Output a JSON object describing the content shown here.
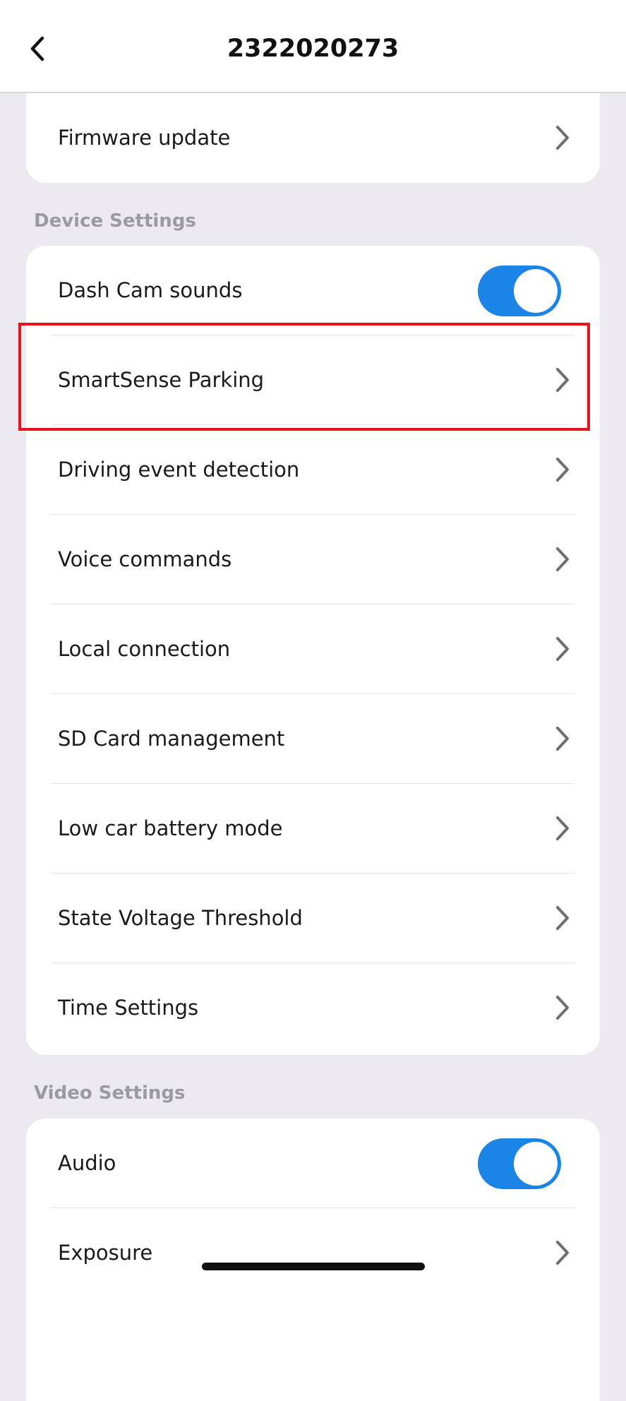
{
  "header": {
    "title": "2322020273",
    "back_icon": "chevron-left-icon"
  },
  "top_card": {
    "rows": [
      {
        "label": "Firmware update",
        "icon": "chevron-right-icon"
      }
    ]
  },
  "device_settings": {
    "section_label": "Device Settings",
    "toggle_row": {
      "label": "Dash Cam sounds",
      "enabled": true
    },
    "rows": [
      {
        "label": "SmartSense Parking",
        "icon": "chevron-right-icon"
      },
      {
        "label": "Driving event detection",
        "icon": "chevron-right-icon"
      },
      {
        "label": "Voice commands",
        "icon": "chevron-right-icon"
      },
      {
        "label": "Local connection",
        "icon": "chevron-right-icon"
      },
      {
        "label": "SD Card management",
        "icon": "chevron-right-icon"
      },
      {
        "label": "Low car battery mode",
        "icon": "chevron-right-icon"
      },
      {
        "label": "State Voltage Threshold",
        "icon": "chevron-right-icon"
      },
      {
        "label": "Time Settings",
        "icon": "chevron-right-icon"
      }
    ]
  },
  "video_settings": {
    "section_label": "Video Settings",
    "toggle_row": {
      "label": "Audio",
      "enabled": true
    },
    "rows": [
      {
        "label": "Exposure",
        "icon": "chevron-right-icon"
      }
    ]
  },
  "colors": {
    "background": "#ECEAF0",
    "toggle_on": "#1B84E7",
    "highlight": "#E8131B",
    "chevron": "#6E6E73",
    "section_text": "#9B9AA1"
  }
}
